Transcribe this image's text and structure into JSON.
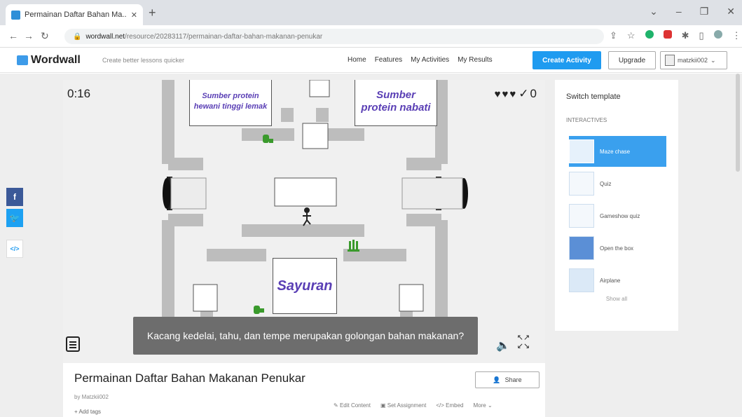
{
  "browser": {
    "tab_title": "Permainan Daftar Bahan Ma...",
    "url_domain": "wordwall.net",
    "url_path": "/resource/20283117/permainan-daftar-bahan-makanan-penukar"
  },
  "header": {
    "logo": "Wordwall",
    "tagline": "Create better lessons quicker",
    "nav": [
      "Home",
      "Features",
      "My Activities",
      "My Results"
    ],
    "create_label": "Create Activity",
    "upgrade_label": "Upgrade",
    "username": "matzkii002"
  },
  "game": {
    "timer": "0:16",
    "score": "0",
    "lives": 3,
    "answers": {
      "a1": "Sumber protein hewani tinggi lemak",
      "a2": "Sumber protein nabati",
      "a3": "Sayuran"
    },
    "question": "Kacang kedelai, tahu, dan tempe merupakan golongan bahan makanan?"
  },
  "activity": {
    "title": "Permainan Daftar Bahan Makanan Penukar",
    "share_label": "Share",
    "author": "by Matzkii002",
    "add_tags": "+ Add tags",
    "actions": [
      "Edit Content",
      "Set Assignment",
      "Embed",
      "More"
    ]
  },
  "templates": {
    "title": "Switch template",
    "subtitle": "INTERACTIVES",
    "items": [
      "Maze chase",
      "Quiz",
      "Gameshow quiz",
      "Open the box",
      "Airplane"
    ],
    "show_all": "Show all"
  },
  "social": {
    "facebook": "f",
    "twitter": "t",
    "embed": "</>"
  },
  "colors": {
    "accent": "#1f9bf0",
    "facebook": "#3b5998",
    "twitter": "#1da1f2",
    "answer_text": "#5a3fb5"
  }
}
